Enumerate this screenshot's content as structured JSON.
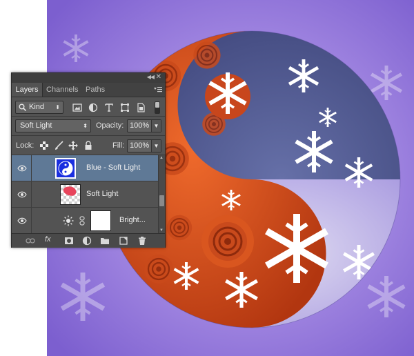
{
  "panel": {
    "tabs": [
      {
        "label": "Layers",
        "active": true
      },
      {
        "label": "Channels",
        "active": false
      },
      {
        "label": "Paths",
        "active": false
      }
    ],
    "filter": {
      "value": "Kind"
    },
    "blend_mode": {
      "value": "Soft Light"
    },
    "opacity": {
      "label": "Opacity:",
      "value": "100%"
    },
    "lock": {
      "label": "Lock:"
    },
    "fill": {
      "label": "Fill:",
      "value": "100%"
    },
    "layers": [
      {
        "name": "Blue - Soft Light",
        "selected": true,
        "thumb_color": "#1a2fe0"
      },
      {
        "name": "Soft Light",
        "selected": false,
        "thumb_color": "#e8455c"
      },
      {
        "name": "Bright...",
        "selected": false,
        "thumb_color": "#ffffff"
      }
    ]
  },
  "colors": {
    "panel_bg": "#535353",
    "selection": "#5f7996",
    "purple_bg": "#8f72d6",
    "rose": "#d8461a",
    "navy": "#3b4377"
  },
  "icons": [
    "search-icon",
    "image-filter-icon",
    "adjustment-filter-icon",
    "type-filter-icon",
    "shape-filter-icon",
    "smartobject-filter-icon",
    "lock-transparent-icon",
    "lock-brush-icon",
    "lock-move-icon",
    "lock-all-icon",
    "eye-icon",
    "brightness-icon",
    "chain-link-icon",
    "link-layers-icon",
    "fx-icon",
    "mask-icon",
    "adjustment-icon",
    "folder-icon",
    "new-layer-icon",
    "trash-icon"
  ]
}
